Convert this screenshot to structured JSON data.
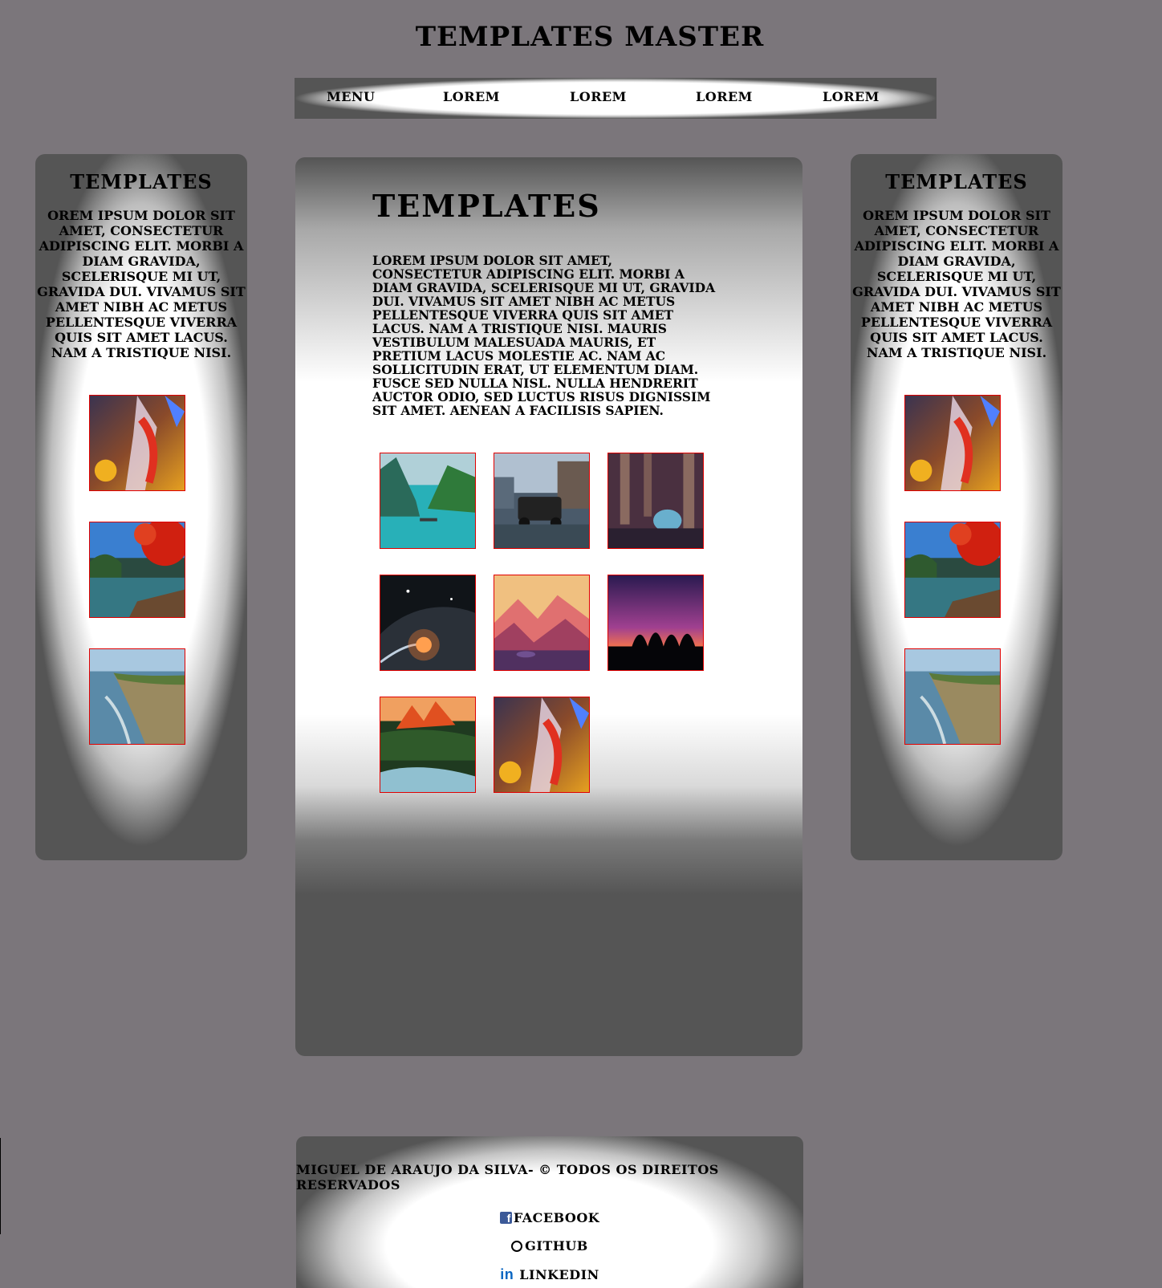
{
  "site": {
    "title": "Templates Master"
  },
  "nav": {
    "items": [
      "Menu",
      "Lorem",
      "Lorem",
      "Lorem",
      "Lorem"
    ]
  },
  "sidebar": {
    "title": "Templates",
    "text": "orem ipsum dolor sit amet, consectetur adipiscing elit. Morbi a diam gravida, scelerisque mi ut, gravida dui. Vivamus sit amet nibh ac metus pellentesque viverra quis sit amet lacus. Nam a tristique nisi.",
    "thumbs": [
      "anime-warrior-image",
      "autumn-lake-image",
      "coastal-cliffs-image"
    ]
  },
  "main": {
    "title": "Templates",
    "text": "Lorem ipsum dolor sit amet, consectetur adipiscing elit. Morbi a diam gravida, scelerisque mi ut, gravida dui. Vivamus sit amet nibh ac metus pellentesque viverra quis sit amet lacus. Nam a tristique nisi. Mauris vestibulum malesuada mauris, et pretium lacus molestie ac. Nam ac sollicitudin erat, ut elementum diam. Fusce sed nulla nisl. Nulla hendrerit auctor odio, sed luctus risus dignissim sit amet. Aenean a facilisis sapien.",
    "gallery": [
      "mountain-lake-image",
      "vintage-car-image",
      "temple-ruins-image",
      "planet-space-image",
      "pink-mountains-image",
      "sunset-trees-image",
      "river-valley-image",
      "anime-warrior-image"
    ]
  },
  "footer": {
    "copyright": "Miguel de Araujo da Silva- © Todos os direitos reservados",
    "links": [
      "Facebook",
      "Github",
      "Linkedin"
    ]
  }
}
